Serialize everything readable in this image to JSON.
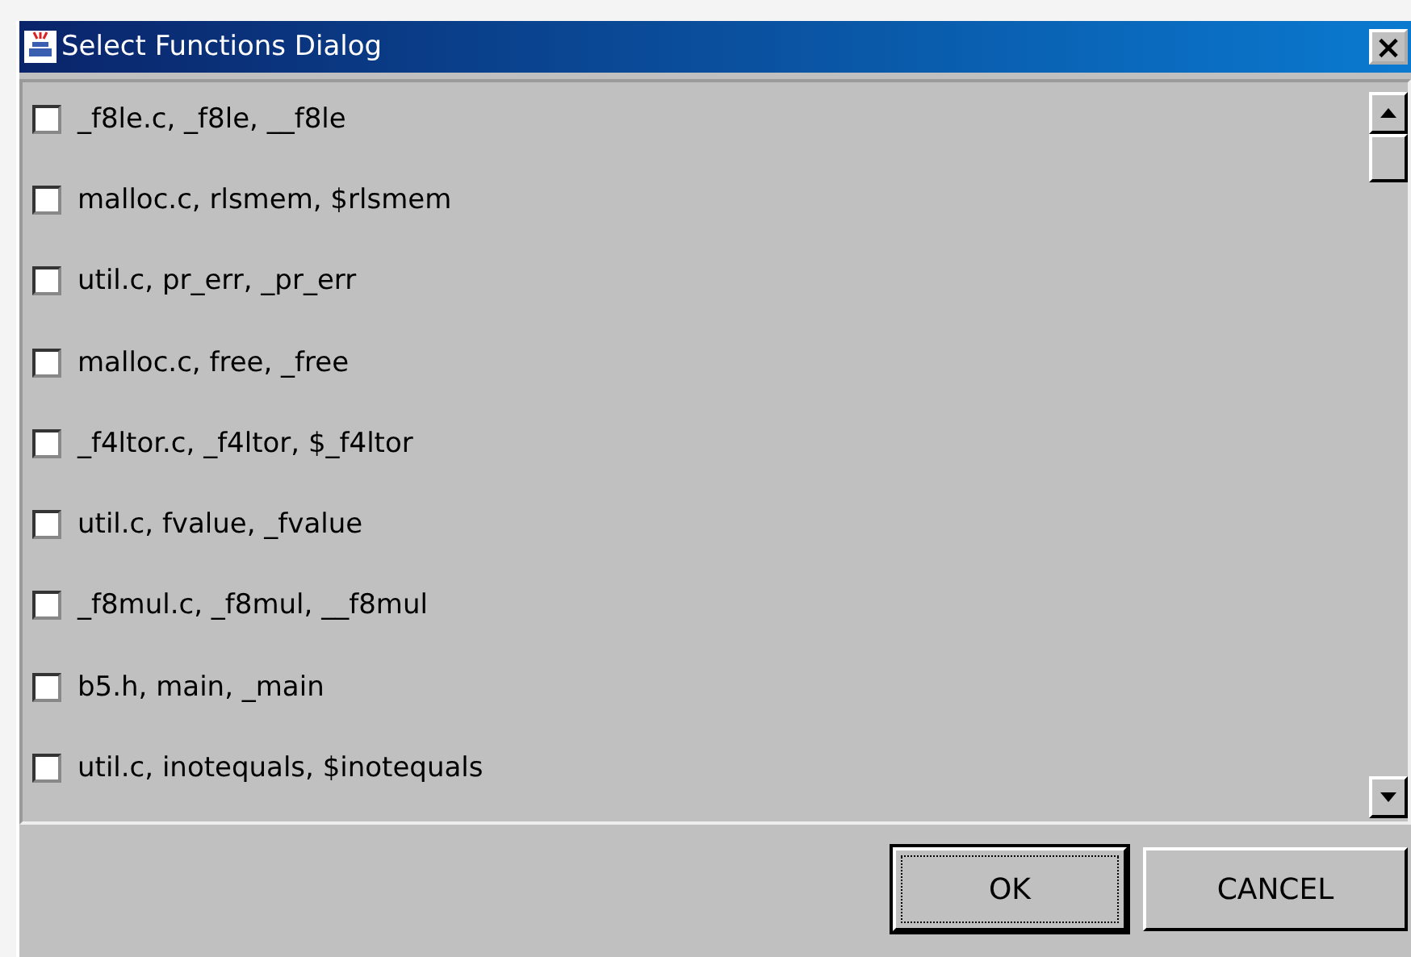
{
  "window": {
    "title": "Select Functions Dialog",
    "close": "×"
  },
  "items": [
    {
      "label": "_f8le.c, _f8le, __f8le",
      "checked": false
    },
    {
      "label": "malloc.c, rlsmem, $rlsmem",
      "checked": false
    },
    {
      "label": "util.c, pr_err, _pr_err",
      "checked": false
    },
    {
      "label": "malloc.c, free, _free",
      "checked": false
    },
    {
      "label": "_f4ltor.c, _f4ltor, $_f4ltor",
      "checked": false
    },
    {
      "label": "util.c, fvalue, _fvalue",
      "checked": false
    },
    {
      "label": "_f8mul.c, _f8mul, __f8mul",
      "checked": false
    },
    {
      "label": "b5.h, main, _main",
      "checked": false
    },
    {
      "label": "util.c, inotequals, $inotequals",
      "checked": false
    }
  ],
  "buttons": [
    {
      "label": "OK",
      "default": true
    },
    {
      "label": "CANCEL",
      "default": false
    }
  ]
}
